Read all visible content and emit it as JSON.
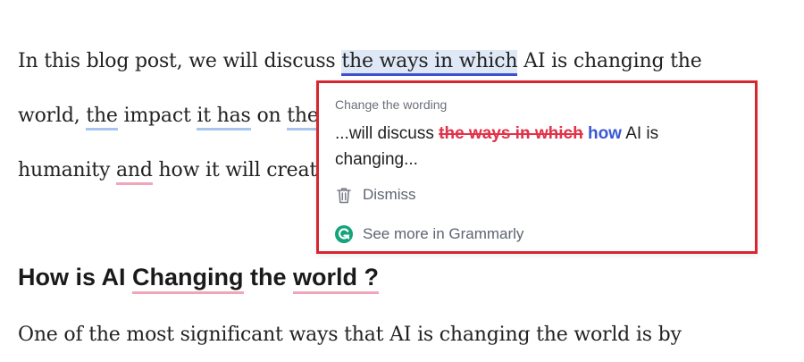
{
  "article": {
    "line1": {
      "before": "In this blog post, we will discuss ",
      "highlight": "the ways in which",
      "after": " AI is changing the"
    },
    "line2": {
      "w1": "world,",
      "s1": " ",
      "w2": "the",
      "s2": " impact ",
      "w3": "it has",
      "s3": " on ",
      "w4": "the"
    },
    "line3": {
      "w1": "humanity ",
      "w2": "and",
      "w3": " how it will create"
    },
    "heading": {
      "p1": "How is AI ",
      "p2": "Changing",
      "p3": " the ",
      "p4": "world ?"
    },
    "line4": "One of the most significant ways that AI is changing the world is by"
  },
  "suggestion_card": {
    "title": "Change the wording",
    "prefix": "...will discuss ",
    "struck": "the ways in which",
    "replacement": "how",
    "suffix": " AI is changing...",
    "dismiss_label": "Dismiss",
    "see_more_label": "See more in Grammarly"
  },
  "colors": {
    "card_border": "#d7262e",
    "strike": "#e0344a",
    "replacement": "#3b58d4",
    "grammarly_green": "#15a37a"
  },
  "icons": {
    "dismiss": "trash-icon",
    "grammarly": "grammarly-logo-icon"
  }
}
